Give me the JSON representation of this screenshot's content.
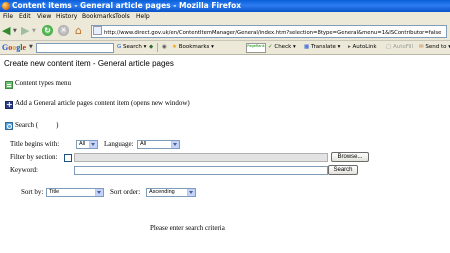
{
  "window": {
    "title": "Content items - General article pages - Mozilla Firefox"
  },
  "menubar": {
    "items": [
      "File",
      "Edit",
      "View",
      "History",
      "Bookmarks",
      "Tools",
      "Help"
    ]
  },
  "navbar": {
    "url": "http://www.direct.gov.uk/en/ContentItemManager/General/index.htm?selection=8type=General&menu=1&ISContributor=false"
  },
  "google_toolbar": {
    "logo": [
      "G",
      "o",
      "o",
      "g",
      "l",
      "e"
    ],
    "search_label": "Search",
    "bookmarks_label": "Bookmarks",
    "pagerank_label": "PageRank",
    "check_label": "Check",
    "translate_label": "Translate",
    "autolink_label": "AutoLink",
    "autofill_label": "AutoFill",
    "sendto_label": "Send to"
  },
  "page": {
    "title": "Create new content item - General article pages",
    "content_types_menu": "Content types menu",
    "add_item": "Add a General article pages content item (opens new window)",
    "search_heading": "Search (",
    "search_heading_close": ")",
    "title_begins_label": "Title begins with:",
    "title_begins_value": "All",
    "language_label": "Language:",
    "language_value": "All",
    "filter_section_label": "Filter by section:",
    "browse_button": "Browse...",
    "keyword_label": "Keyword:",
    "keyword_value": "",
    "search_button": "Search",
    "sort_by_label": "Sort by:",
    "sort_by_value": "Title",
    "sort_order_label": "Sort order:",
    "sort_order_value": "Ascending",
    "status_message": "Please enter search criteria"
  }
}
